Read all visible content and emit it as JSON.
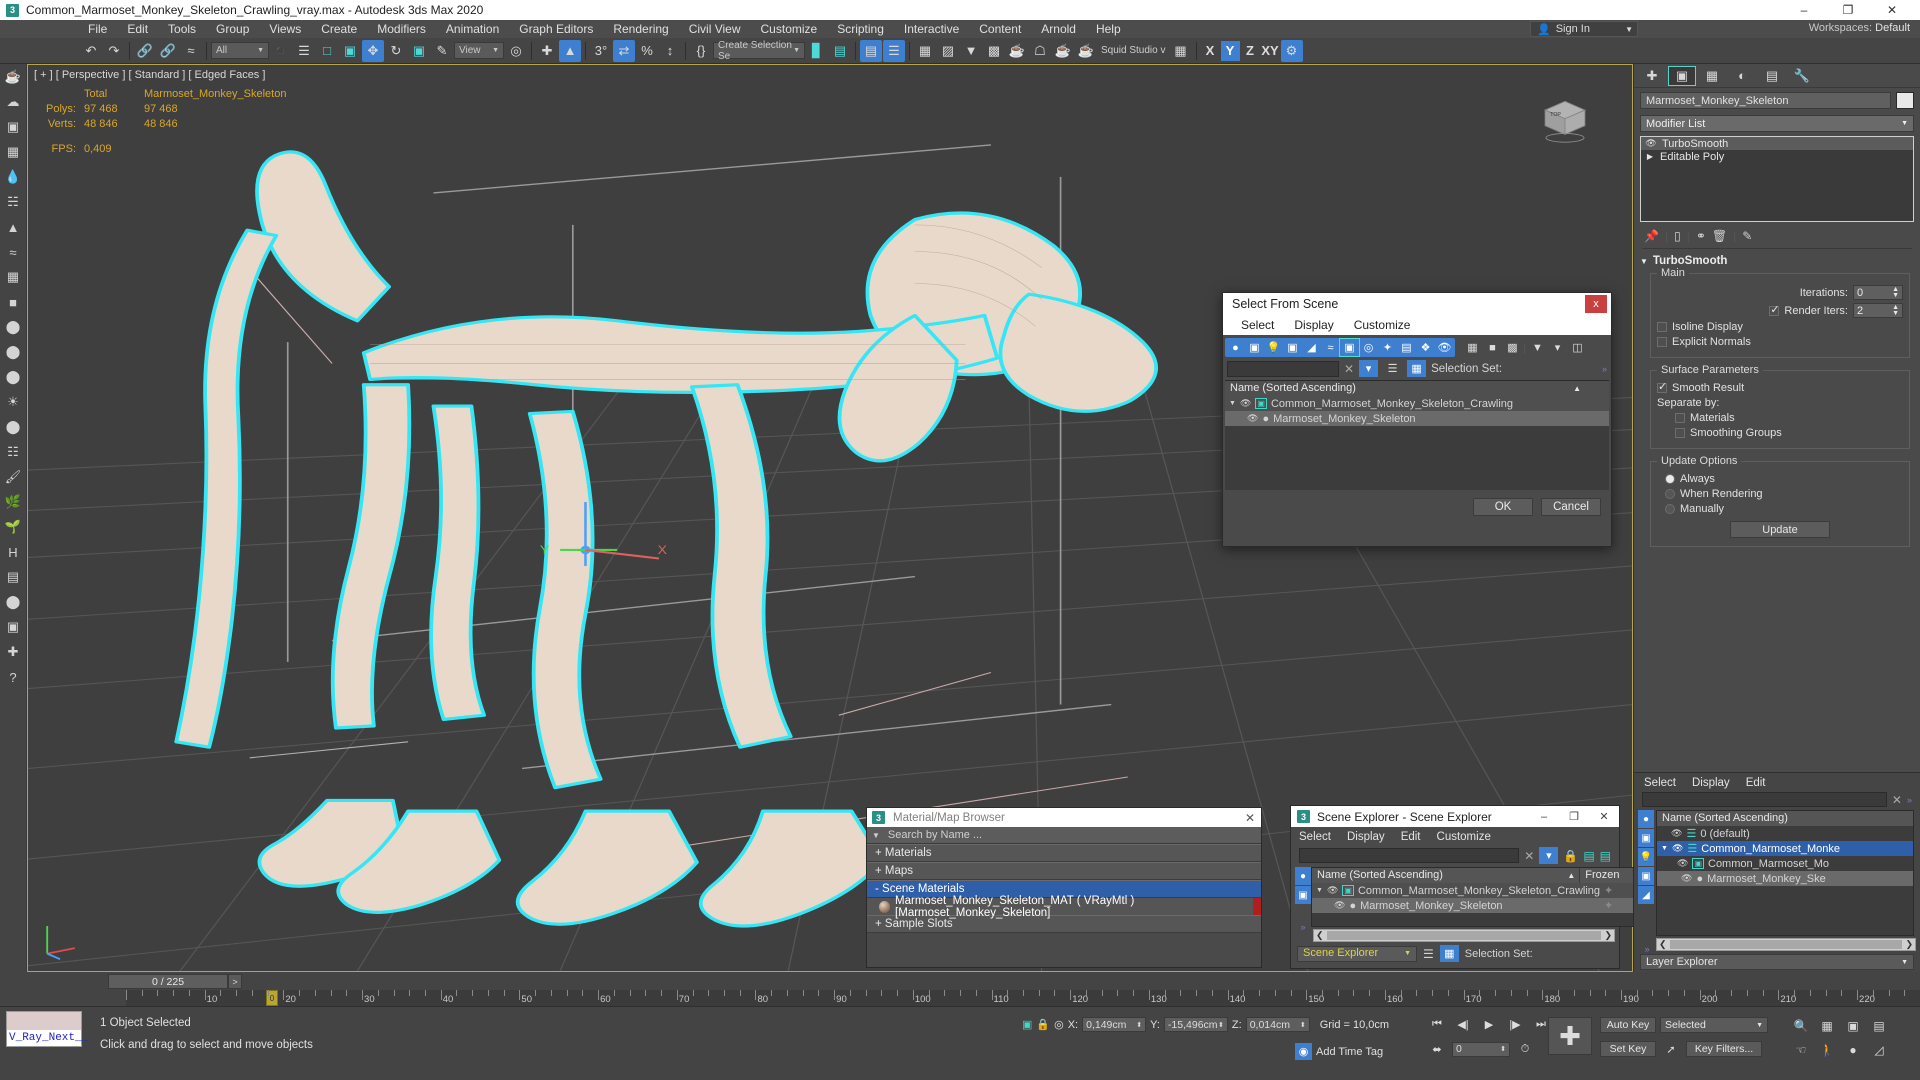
{
  "titlebar": {
    "app_icon": "max-icon",
    "title": "Common_Marmoset_Monkey_Skeleton_Crawling_vray.max - Autodesk 3ds Max 2020",
    "minimize": "–",
    "maximize": "❐",
    "close": "✕"
  },
  "menubar": {
    "items": [
      "File",
      "Edit",
      "Tools",
      "Group",
      "Views",
      "Create",
      "Modifiers",
      "Animation",
      "Graph Editors",
      "Rendering",
      "Civil View",
      "Customize",
      "Scripting",
      "Interactive",
      "Content",
      "Arnold",
      "Help"
    ],
    "sign_in": "Sign In",
    "workspaces_label": "Workspaces:",
    "workspaces_value": "Default"
  },
  "toolbar": {
    "selection_filter": "All",
    "view_coord": "View",
    "selection_set_placeholder": "Create Selection Se",
    "renderer_label": "Squid Studio v",
    "axis_x": "X",
    "axis_y": "Y",
    "axis_z": "Z",
    "axis_xy": "XY"
  },
  "viewport": {
    "label": "[ + ] [ Perspective ] [ Standard ] [ Edged Faces ]",
    "stats": {
      "col_total": "Total",
      "col_object": "Marmoset_Monkey_Skeleton",
      "rows": [
        {
          "label": "Polys:",
          "total": "97 468",
          "object": "97 468"
        },
        {
          "label": "Verts:",
          "total": "48 846",
          "object": "48 846"
        }
      ],
      "fps_label": "FPS:",
      "fps_value": "0,409"
    }
  },
  "command_panel": {
    "object_name": "Marmoset_Monkey_Skeleton",
    "modifier_list": "Modifier List",
    "stack": [
      {
        "label": "TurboSmooth",
        "selected": true
      },
      {
        "label": "Editable Poly",
        "selected": false
      }
    ],
    "rollout_title": "TurboSmooth",
    "main_group": "Main",
    "iterations_label": "Iterations:",
    "iterations_value": "0",
    "render_iters_label": "Render Iters:",
    "render_iters_value": "2",
    "isoline_display": "Isoline Display",
    "explicit_normals": "Explicit Normals",
    "surface_group": "Surface Parameters",
    "smooth_result": "Smooth Result",
    "separate_by": "Separate by:",
    "materials": "Materials",
    "smoothing_groups": "Smoothing Groups",
    "update_group": "Update Options",
    "update_always": "Always",
    "update_when_rendering": "When Rendering",
    "update_manually": "Manually",
    "update_button": "Update"
  },
  "docked_explorer": {
    "menu": [
      "Select",
      "Display",
      "Edit"
    ],
    "header": "Name (Sorted Ascending)",
    "rows": [
      {
        "label": "0 (default)",
        "state": "normal"
      },
      {
        "label": "Common_Marmoset_Monke",
        "state": "selected"
      },
      {
        "label": "Common_Marmoset_Mo",
        "state": "normal"
      },
      {
        "label": "Marmoset_Monkey_Ske",
        "state": "highlight"
      }
    ],
    "footer_combo": "Layer Explorer"
  },
  "select_from_scene": {
    "title": "Select From Scene",
    "close": "x",
    "menu": [
      "Select",
      "Display",
      "Customize"
    ],
    "search_value": "",
    "selection_set_label": "Selection Set:",
    "header": "Name (Sorted Ascending)",
    "rows": [
      {
        "label": "Common_Marmoset_Monkey_Skeleton_Crawling",
        "indent": 0,
        "selected": false
      },
      {
        "label": "Marmoset_Monkey_Skeleton",
        "indent": 1,
        "selected": true
      }
    ],
    "ok": "OK",
    "cancel": "Cancel"
  },
  "material_browser": {
    "title": "Material/Map Browser",
    "search_placeholder": "Search by Name ...",
    "sections": [
      {
        "label": "+ Materials",
        "open": false
      },
      {
        "label": "+ Maps",
        "open": false
      },
      {
        "label": "- Scene Materials",
        "open": true
      },
      {
        "label": "+ Sample Slots",
        "open": false
      }
    ],
    "scene_material": "Marmoset_Monkey_Skeleton_MAT ( VRayMtl ) [Marmoset_Monkey_Skeleton]"
  },
  "scene_explorer_window": {
    "title": "Scene Explorer - Scene Explorer",
    "minimize": "–",
    "maximize": "❐",
    "close": "✕",
    "menu": [
      "Select",
      "Display",
      "Edit",
      "Customize"
    ],
    "header_name": "Name (Sorted Ascending)",
    "header_frozen": "Frozen",
    "rows": [
      {
        "label": "Common_Marmoset_Monkey_Skeleton_Crawling",
        "indent": 0,
        "selected": false
      },
      {
        "label": "Marmoset_Monkey_Skeleton",
        "indent": 1,
        "selected": true
      }
    ],
    "footer_combo": "Scene Explorer",
    "selection_set_label": "Selection Set:"
  },
  "timeline": {
    "frame_display": "0 / 225",
    "prev": "<",
    "next": ">",
    "ticks": [
      {
        "value": "10",
        "pos": 10
      },
      {
        "value": "20",
        "pos": 20
      },
      {
        "value": "30",
        "pos": 30
      },
      {
        "value": "40",
        "pos": 40
      },
      {
        "value": "50",
        "pos": 50
      },
      {
        "value": "60",
        "pos": 60
      },
      {
        "value": "70",
        "pos": 70
      },
      {
        "value": "80",
        "pos": 80
      },
      {
        "value": "90",
        "pos": 90
      },
      {
        "value": "100",
        "pos": 100
      },
      {
        "value": "110",
        "pos": 110
      },
      {
        "value": "120",
        "pos": 120
      },
      {
        "value": "130",
        "pos": 130
      },
      {
        "value": "140",
        "pos": 140
      },
      {
        "value": "150",
        "pos": 150
      },
      {
        "value": "160",
        "pos": 160
      },
      {
        "value": "170",
        "pos": 170
      },
      {
        "value": "180",
        "pos": 180
      },
      {
        "value": "190",
        "pos": 190
      },
      {
        "value": "200",
        "pos": 200
      },
      {
        "value": "210",
        "pos": 210
      },
      {
        "value": "220",
        "pos": 220
      }
    ],
    "current_frame": "0"
  },
  "statusbar": {
    "maxscript_listener": "V_Ray_Next__",
    "selection_status": "1 Object Selected",
    "prompt": "Click and drag to select and move objects",
    "x_label": "X:",
    "x_value": "0,149cm",
    "y_label": "Y:",
    "y_value": "-15,496cm",
    "z_label": "Z:",
    "z_value": "0,014cm",
    "grid": "Grid = 10,0cm",
    "add_time_tag": "Add Time Tag",
    "auto_key": "Auto Key",
    "set_key": "Set Key",
    "key_mode": "Selected",
    "key_filters": "Key Filters...",
    "current_time": "0"
  }
}
